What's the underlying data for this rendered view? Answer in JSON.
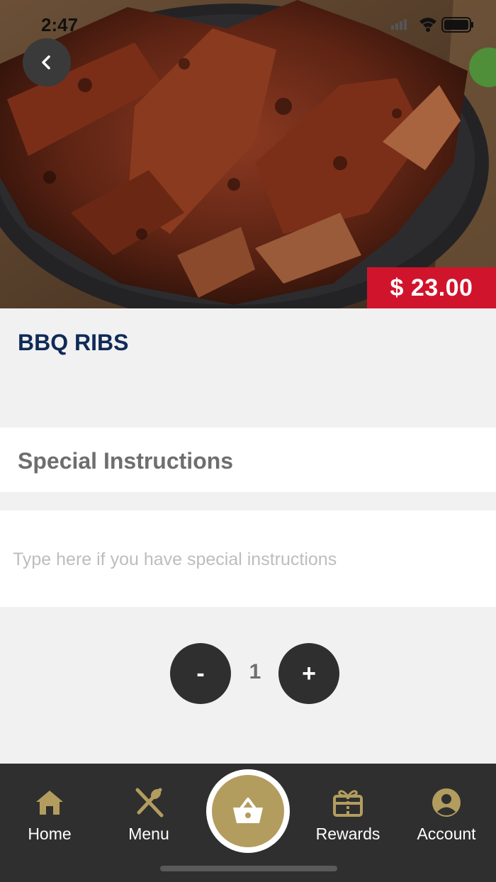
{
  "status_bar": {
    "time": "2:47"
  },
  "product": {
    "price": "$ 23.00",
    "title": "BBQ RIBS",
    "image_alt": "Grilled BBQ ribs on a dark plate"
  },
  "special_instructions": {
    "title": "Special Instructions",
    "placeholder": "Type here if you have special instructions",
    "value": ""
  },
  "quantity": {
    "minus_label": "-",
    "value": "1",
    "plus_label": "+"
  },
  "tabbar": {
    "items": [
      {
        "label": "Home",
        "icon": "home-icon"
      },
      {
        "label": "Menu",
        "icon": "utensils-icon"
      },
      {
        "label": "",
        "icon": "basket-icon"
      },
      {
        "label": "Rewards",
        "icon": "gift-icon"
      },
      {
        "label": "Account",
        "icon": "account-icon"
      }
    ]
  },
  "colors": {
    "accent_gold": "#b39d5e",
    "price_red": "#d0142c",
    "title_navy": "#0f2a57",
    "dark": "#2f2f2f"
  }
}
